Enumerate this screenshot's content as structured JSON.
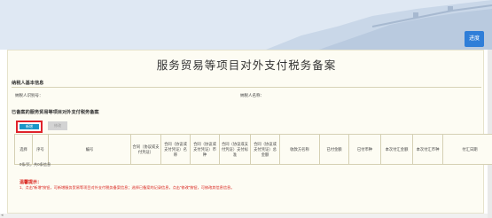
{
  "header": {
    "progress_label": "进度"
  },
  "page": {
    "title": "服务贸易等项目对外支付税务备案"
  },
  "basic_info": {
    "heading": "纳税人基本信息",
    "tax_id_label": "纳税人识别号：",
    "taxpayer_name_label": "纳税人名称："
  },
  "records": {
    "heading": "已备案的服务贸易等项目对外支付税务备案",
    "add_label": "新增",
    "modify_label": "修改",
    "columns": [
      "选择",
      "序号",
      "编号",
      "合同（协议或支付凭证）",
      "合同（协议或支付凭证）名称",
      "合同（协议或支付凭证）币种",
      "合同（协议或支付凭证）支付标准",
      "合同（协议或支付凭证）总金额",
      "收款方名称",
      "已付金额",
      "已付币种",
      "本次付汇金额",
      "本次付汇币种",
      "付汇日期"
    ],
    "count_text": "0条/页，共0条信息"
  },
  "tips": {
    "title": "温馨提示：",
    "text": "1、点击“新增”按钮，可新增服务贸易等项目对外支付税务备案信息；选择已备案的记录信息，点击“修改”按钮，可修改其信息信息。"
  },
  "colors": {
    "accent": "#2f7ed8",
    "add_button": "#1a96c8",
    "highlight_border": "#e0232b",
    "tips": "#d9221c"
  }
}
